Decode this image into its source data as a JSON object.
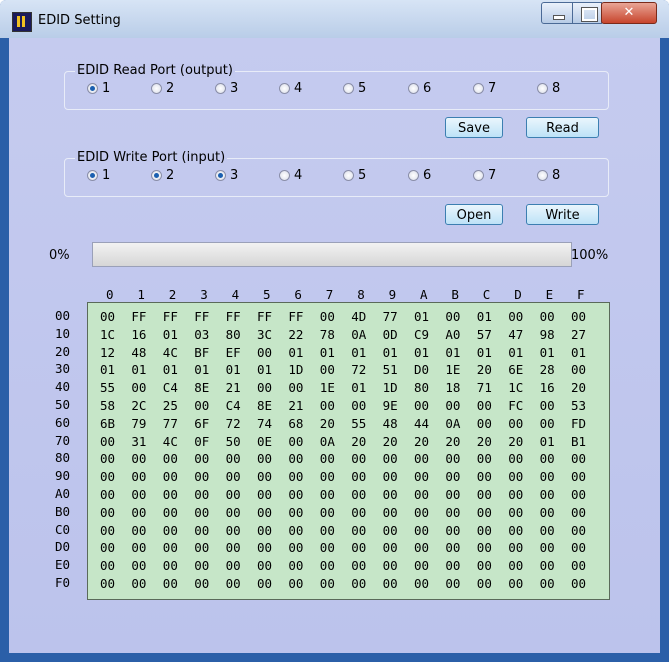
{
  "window": {
    "title": "EDID Setting",
    "controls": [
      "minimize",
      "maximize",
      "close"
    ]
  },
  "read_port": {
    "title": "EDID Read Port (output)",
    "options": [
      "1",
      "2",
      "3",
      "4",
      "5",
      "6",
      "7",
      "8"
    ],
    "selected": [
      "1"
    ]
  },
  "write_port": {
    "title": "EDID Write Port (input)",
    "options": [
      "1",
      "2",
      "3",
      "4",
      "5",
      "6",
      "7",
      "8"
    ],
    "selected": [
      "1",
      "2",
      "3"
    ]
  },
  "buttons": {
    "save": "Save",
    "read": "Read",
    "open": "Open",
    "write": "Write"
  },
  "progress": {
    "min_label": "0%",
    "max_label": "100%",
    "value": 0
  },
  "hex": {
    "columns": [
      "0",
      "1",
      "2",
      "3",
      "4",
      "5",
      "6",
      "7",
      "8",
      "9",
      "A",
      "B",
      "C",
      "D",
      "E",
      "F"
    ],
    "rows": [
      {
        "label": "00",
        "values": [
          "00",
          "FF",
          "FF",
          "FF",
          "FF",
          "FF",
          "FF",
          "00",
          "4D",
          "77",
          "01",
          "00",
          "01",
          "00",
          "00",
          "00"
        ]
      },
      {
        "label": "10",
        "values": [
          "1C",
          "16",
          "01",
          "03",
          "80",
          "3C",
          "22",
          "78",
          "0A",
          "0D",
          "C9",
          "A0",
          "57",
          "47",
          "98",
          "27"
        ]
      },
      {
        "label": "20",
        "values": [
          "12",
          "48",
          "4C",
          "BF",
          "EF",
          "00",
          "01",
          "01",
          "01",
          "01",
          "01",
          "01",
          "01",
          "01",
          "01",
          "01"
        ]
      },
      {
        "label": "30",
        "values": [
          "01",
          "01",
          "01",
          "01",
          "01",
          "01",
          "1D",
          "00",
          "72",
          "51",
          "D0",
          "1E",
          "20",
          "6E",
          "28",
          "00"
        ]
      },
      {
        "label": "40",
        "values": [
          "55",
          "00",
          "C4",
          "8E",
          "21",
          "00",
          "00",
          "1E",
          "01",
          "1D",
          "80",
          "18",
          "71",
          "1C",
          "16",
          "20"
        ]
      },
      {
        "label": "50",
        "values": [
          "58",
          "2C",
          "25",
          "00",
          "C4",
          "8E",
          "21",
          "00",
          "00",
          "9E",
          "00",
          "00",
          "00",
          "FC",
          "00",
          "53"
        ]
      },
      {
        "label": "60",
        "values": [
          "6B",
          "79",
          "77",
          "6F",
          "72",
          "74",
          "68",
          "20",
          "55",
          "48",
          "44",
          "0A",
          "00",
          "00",
          "00",
          "FD"
        ]
      },
      {
        "label": "70",
        "values": [
          "00",
          "31",
          "4C",
          "0F",
          "50",
          "0E",
          "00",
          "0A",
          "20",
          "20",
          "20",
          "20",
          "20",
          "20",
          "01",
          "B1"
        ]
      },
      {
        "label": "80",
        "values": [
          "00",
          "00",
          "00",
          "00",
          "00",
          "00",
          "00",
          "00",
          "00",
          "00",
          "00",
          "00",
          "00",
          "00",
          "00",
          "00"
        ]
      },
      {
        "label": "90",
        "values": [
          "00",
          "00",
          "00",
          "00",
          "00",
          "00",
          "00",
          "00",
          "00",
          "00",
          "00",
          "00",
          "00",
          "00",
          "00",
          "00"
        ]
      },
      {
        "label": "A0",
        "values": [
          "00",
          "00",
          "00",
          "00",
          "00",
          "00",
          "00",
          "00",
          "00",
          "00",
          "00",
          "00",
          "00",
          "00",
          "00",
          "00"
        ]
      },
      {
        "label": "B0",
        "values": [
          "00",
          "00",
          "00",
          "00",
          "00",
          "00",
          "00",
          "00",
          "00",
          "00",
          "00",
          "00",
          "00",
          "00",
          "00",
          "00"
        ]
      },
      {
        "label": "C0",
        "values": [
          "00",
          "00",
          "00",
          "00",
          "00",
          "00",
          "00",
          "00",
          "00",
          "00",
          "00",
          "00",
          "00",
          "00",
          "00",
          "00"
        ]
      },
      {
        "label": "D0",
        "values": [
          "00",
          "00",
          "00",
          "00",
          "00",
          "00",
          "00",
          "00",
          "00",
          "00",
          "00",
          "00",
          "00",
          "00",
          "00",
          "00"
        ]
      },
      {
        "label": "E0",
        "values": [
          "00",
          "00",
          "00",
          "00",
          "00",
          "00",
          "00",
          "00",
          "00",
          "00",
          "00",
          "00",
          "00",
          "00",
          "00",
          "00"
        ]
      },
      {
        "label": "F0",
        "values": [
          "00",
          "00",
          "00",
          "00",
          "00",
          "00",
          "00",
          "00",
          "00",
          "00",
          "00",
          "00",
          "00",
          "00",
          "00",
          "00"
        ]
      }
    ]
  }
}
